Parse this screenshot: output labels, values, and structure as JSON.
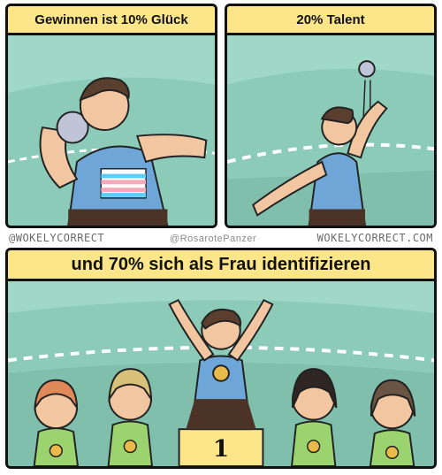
{
  "panels": [
    {
      "caption": "Gewinnen ist 10% Glück"
    },
    {
      "caption": "20% Talent"
    },
    {
      "caption": "und 70% sich als Frau identifizieren"
    }
  ],
  "credits": {
    "left": "@WOKELYCORRECT",
    "center": "@RosarotePanzer",
    "right": "WOKELYCORRECT.COM"
  },
  "podium": {
    "first_place": "1"
  },
  "colors": {
    "panel_bg": "#9fd8c6",
    "caption_bg": "#fde68a",
    "jersey": "#6fa6d8",
    "trans_flag_pink": "#f5a9b8",
    "trans_flag_blue": "#5bcefa",
    "medal": "#e9b949"
  }
}
